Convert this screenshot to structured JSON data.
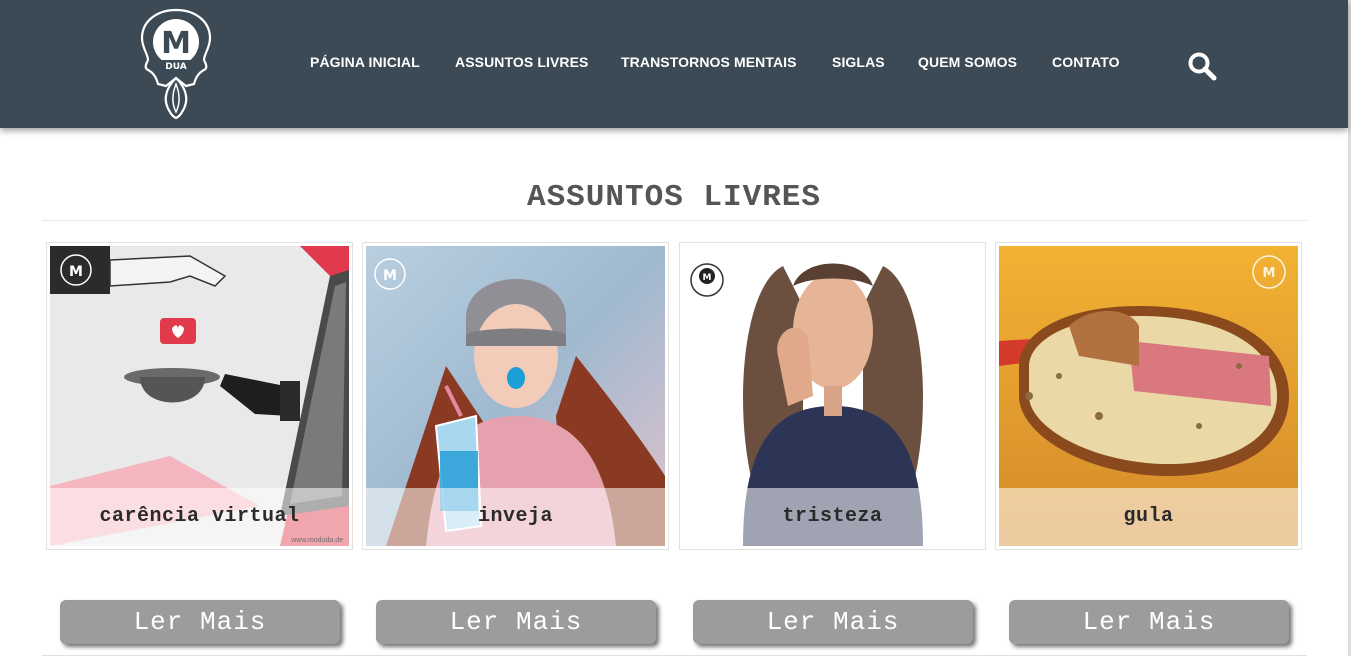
{
  "header": {
    "logo_text": "DUA",
    "logo_letter": "M",
    "nav": [
      {
        "label": "PÁGINA INICIAL"
      },
      {
        "label": "ASSUNTOS LIVRES"
      },
      {
        "label": "TRANSTORNOS MENTAIS"
      },
      {
        "label": "SIGLAS"
      },
      {
        "label": "QUEM SOMOS"
      },
      {
        "label": "CONTATO"
      }
    ],
    "search_icon": "search-icon",
    "background_color": "#3b4a54"
  },
  "section": {
    "title": "ASSUNTOS LIVRES"
  },
  "cards": [
    {
      "caption": "carência virtual",
      "button_label": "Ler Mais",
      "watermark": "www.moduda.de"
    },
    {
      "caption": "inveja",
      "button_label": "Ler Mais"
    },
    {
      "caption": "tristeza",
      "button_label": "Ler Mais"
    },
    {
      "caption": "gula",
      "button_label": "Ler Mais"
    }
  ],
  "colors": {
    "button_bg": "#9c9c9c",
    "title_text": "#555555"
  }
}
